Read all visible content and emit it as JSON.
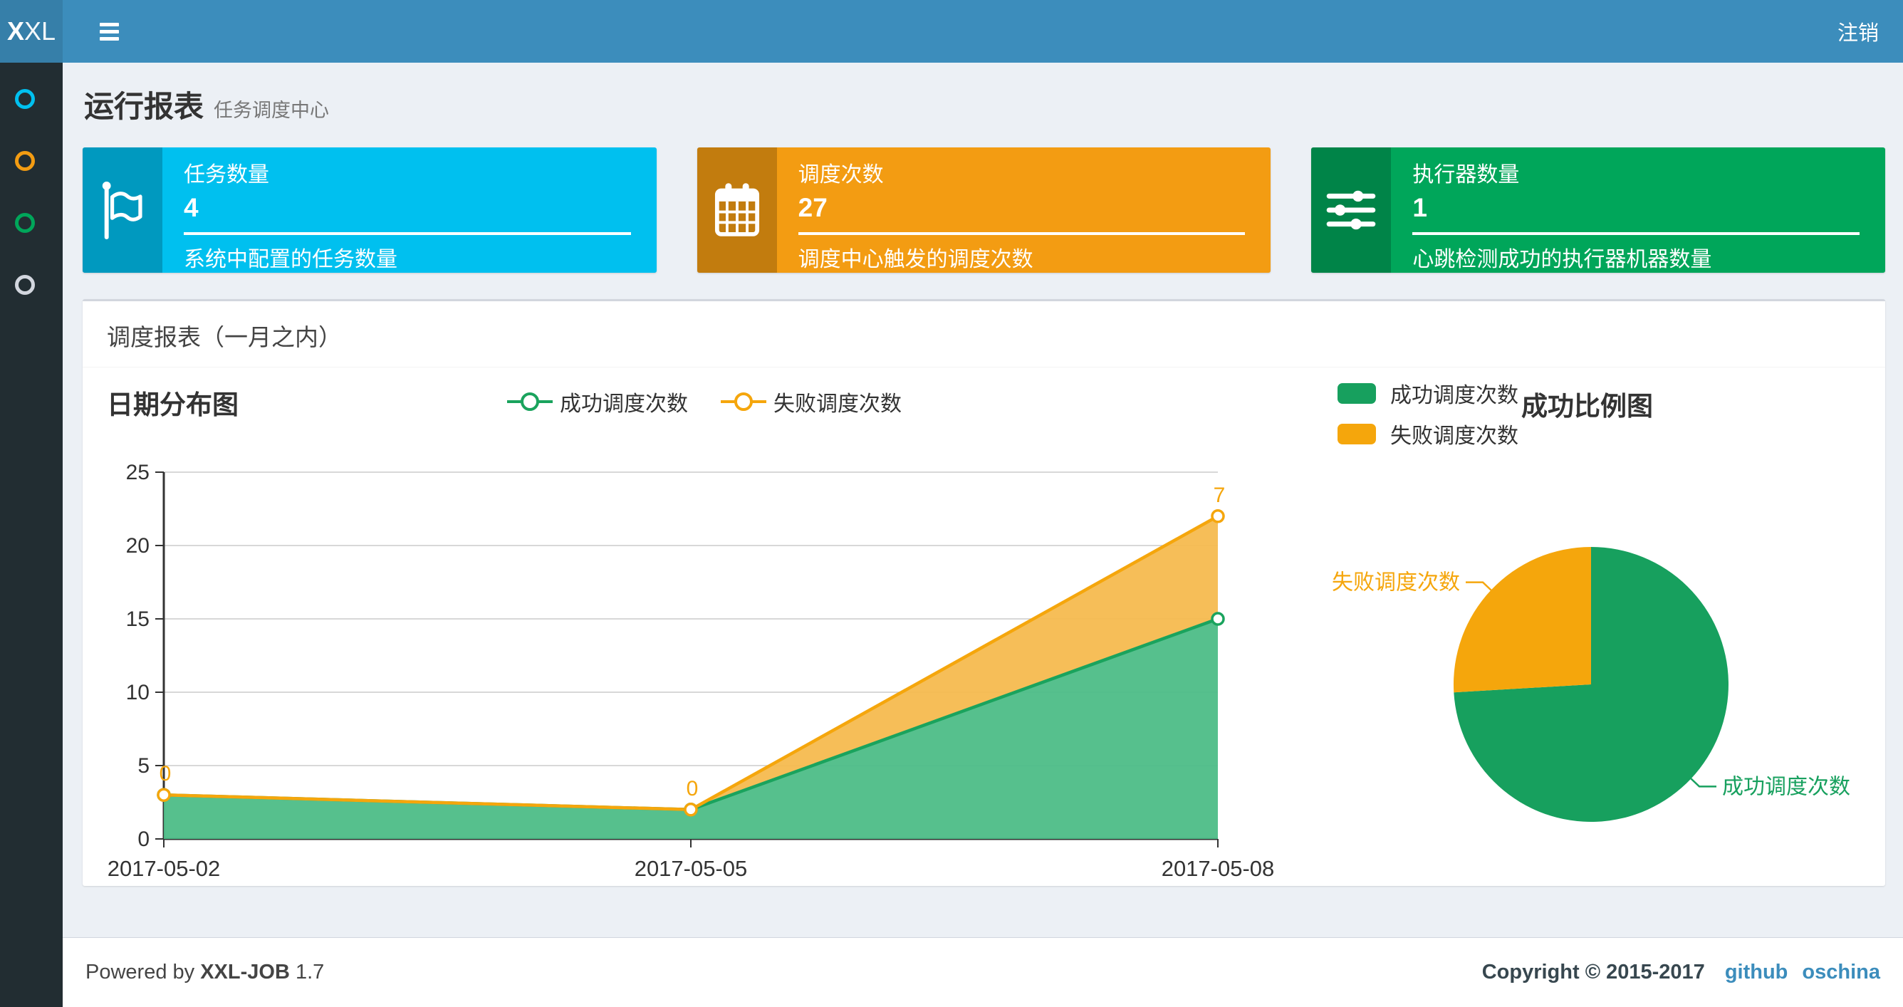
{
  "navbar": {
    "logo_bold": "X",
    "logo_light": "XL",
    "logout_label": "注销"
  },
  "sidebar": {
    "items": [
      {
        "icon": "circle-o-icon",
        "color": "#00c0ef"
      },
      {
        "icon": "circle-o-icon",
        "color": "#f39c12"
      },
      {
        "icon": "circle-o-icon",
        "color": "#00a65a"
      },
      {
        "icon": "circle-o-icon",
        "color": "#d2d6de"
      }
    ]
  },
  "page": {
    "title": "运行报表",
    "subtitle": "任务调度中心"
  },
  "info_boxes": [
    {
      "icon": "flag-icon",
      "label": "任务数量",
      "value": "4",
      "desc": "系统中配置的任务数量",
      "color": "#00c0ef"
    },
    {
      "icon": "calendar-icon",
      "label": "调度次数",
      "value": "27",
      "desc": "调度中心触发的调度次数",
      "color": "#f39c12"
    },
    {
      "icon": "sliders-icon",
      "label": "执行器数量",
      "value": "1",
      "desc": "心跳检测成功的执行器机器数量",
      "color": "#00a65a"
    }
  ],
  "panel": {
    "title": "调度报表（一月之内）"
  },
  "colors": {
    "navbar": "#3c8dbc",
    "logo_bg": "#367fa9",
    "sidebar_bg": "#222d32",
    "content_bg": "#ecf0f5",
    "success": "#1aa35d",
    "success_fill": "#4dbd87",
    "fail": "#f5a60c",
    "fail_fill": "#f6ba4f",
    "pie_success": "#17a05e",
    "pie_fail": "#f5a60c",
    "axis": "#333333",
    "grid": "#cccccc",
    "link": "#3c8dbc"
  },
  "chart_data": [
    {
      "type": "area",
      "title": "日期分布图",
      "categories": [
        "2017-05-02",
        "2017-05-05",
        "2017-05-08"
      ],
      "series": [
        {
          "name": "成功调度次数",
          "values": [
            3,
            2,
            15
          ],
          "color": "#1aa35d",
          "fill": "#4dbd87"
        },
        {
          "name": "失败调度次数",
          "values": [
            0,
            0,
            7
          ],
          "color": "#f5a60c",
          "fill": "#f6ba4f",
          "show_labels": true
        }
      ],
      "stacked": true,
      "xlabel": "",
      "ylabel": "",
      "ylim": [
        0,
        25
      ],
      "yticks": [
        0,
        5,
        10,
        15,
        20,
        25
      ],
      "grid": true,
      "legend_position": "top-center"
    },
    {
      "type": "pie",
      "title": "成功比例图",
      "slices": [
        {
          "name": "成功调度次数",
          "value": 20,
          "color": "#17a05e"
        },
        {
          "name": "失败调度次数",
          "value": 7,
          "color": "#f5a60c"
        }
      ],
      "legend_position": "top-left",
      "labels": "callout"
    }
  ],
  "footer": {
    "powered_prefix": "Powered by",
    "product": "XXL-JOB",
    "version": "1.7",
    "copyright": "Copyright © 2015-2017",
    "links": [
      {
        "label": "github"
      },
      {
        "label": "oschina"
      }
    ]
  }
}
